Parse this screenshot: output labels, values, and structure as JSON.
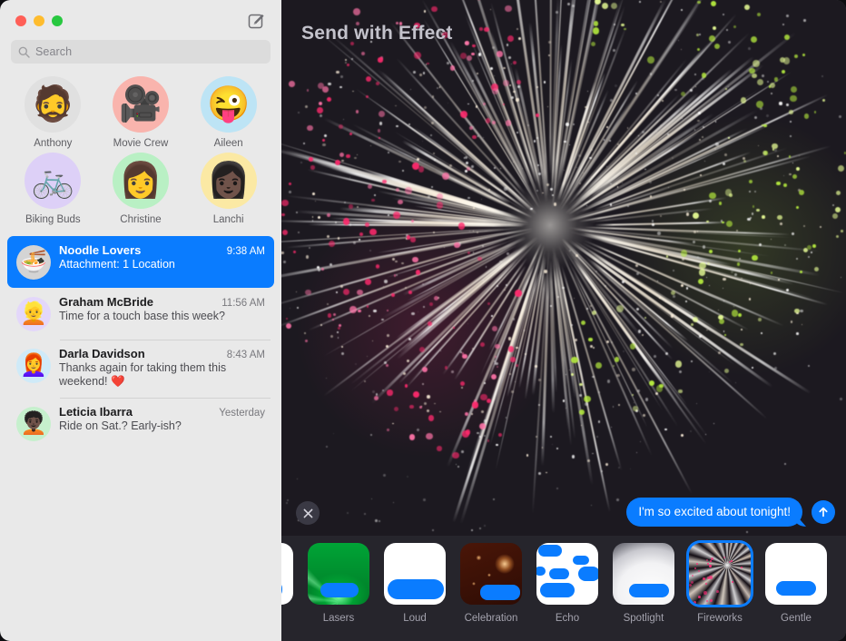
{
  "window": {
    "traffic_lights": [
      "close",
      "minimize",
      "maximize"
    ],
    "colors": {
      "accent_blue": "#0a7cff",
      "sidebar_bg": "#e9e9e9",
      "main_bg": "#26252c",
      "stage_bg": "#1c1920",
      "traffic_close": "#ff5f57",
      "traffic_min": "#febc2e",
      "traffic_max": "#28c840"
    }
  },
  "sidebar": {
    "compose_icon": "compose-pencil-square-icon",
    "search": {
      "icon": "search-icon",
      "placeholder": "Search",
      "value": ""
    },
    "pinned": [
      {
        "name": "Anthony",
        "glyph": "🧔",
        "bg": "#e0e0e0",
        "icon": "memoji-avatar"
      },
      {
        "name": "Movie Crew",
        "glyph": "🎥",
        "bg": "#f9b4ad",
        "icon": "movie-camera-avatar"
      },
      {
        "name": "Aileen",
        "glyph": "😜",
        "bg": "#bde4f5",
        "icon": "memoji-avatar"
      },
      {
        "name": "Biking Buds",
        "glyph": "🚲",
        "bg": "#ddd0f7",
        "icon": "bicycle-avatar"
      },
      {
        "name": "Christine",
        "glyph": "👩",
        "bg": "#b9f0c4",
        "icon": "memoji-avatar"
      },
      {
        "name": "Lanchi",
        "glyph": "👩🏿",
        "bg": "#fbe9a4",
        "icon": "memoji-avatar"
      }
    ],
    "conversations": [
      {
        "name": "Noodle Lovers",
        "time": "9:38 AM",
        "preview": "Attachment: 1 Location",
        "selected": true,
        "glyph": "🍜",
        "bg": "#d4d4d4",
        "icon": "noodle-bowl-avatar"
      },
      {
        "name": "Graham McBride",
        "time": "11:56 AM",
        "preview": "Time for a touch base this week?",
        "selected": false,
        "glyph": "👱",
        "bg": "#e3d7fa",
        "icon": "memoji-avatar"
      },
      {
        "name": "Darla Davidson",
        "time": "8:43 AM",
        "preview": "Thanks again for taking them this weekend! ❤️",
        "selected": false,
        "glyph": "👩‍🦰",
        "bg": "#cfeaf8",
        "icon": "memoji-avatar"
      },
      {
        "name": "Leticia Ibarra",
        "time": "Yesterday",
        "preview": "Ride on Sat.? Early-ish?",
        "selected": false,
        "glyph": "🧑🏿‍🦱",
        "bg": "#c6f0cd",
        "icon": "memoji-avatar"
      }
    ]
  },
  "main": {
    "title": "Send with Effect",
    "preview_effect": "Fireworks",
    "close_button": {
      "icon": "close-x-icon",
      "label": ""
    },
    "message": {
      "text": "I'm so excited about tonight!",
      "bubble_color": "#0a7cff"
    },
    "send_button": {
      "icon": "send-arrow-up-icon",
      "label": ""
    },
    "effects": [
      {
        "label": "",
        "key": "partial",
        "selected": false,
        "thumb": "bubble-white"
      },
      {
        "label": "Lasers",
        "key": "lasers",
        "selected": false,
        "thumb": "lasers"
      },
      {
        "label": "Loud",
        "key": "loud",
        "selected": false,
        "thumb": "loud"
      },
      {
        "label": "Celebration",
        "key": "celebration",
        "selected": false,
        "thumb": "celebration"
      },
      {
        "label": "Echo",
        "key": "echo",
        "selected": false,
        "thumb": "echo"
      },
      {
        "label": "Spotlight",
        "key": "spotlight",
        "selected": false,
        "thumb": "spotlight"
      },
      {
        "label": "Fireworks",
        "key": "fireworks",
        "selected": true,
        "thumb": "fireworks"
      },
      {
        "label": "Gentle",
        "key": "gentle",
        "selected": false,
        "thumb": "gentle"
      }
    ]
  }
}
